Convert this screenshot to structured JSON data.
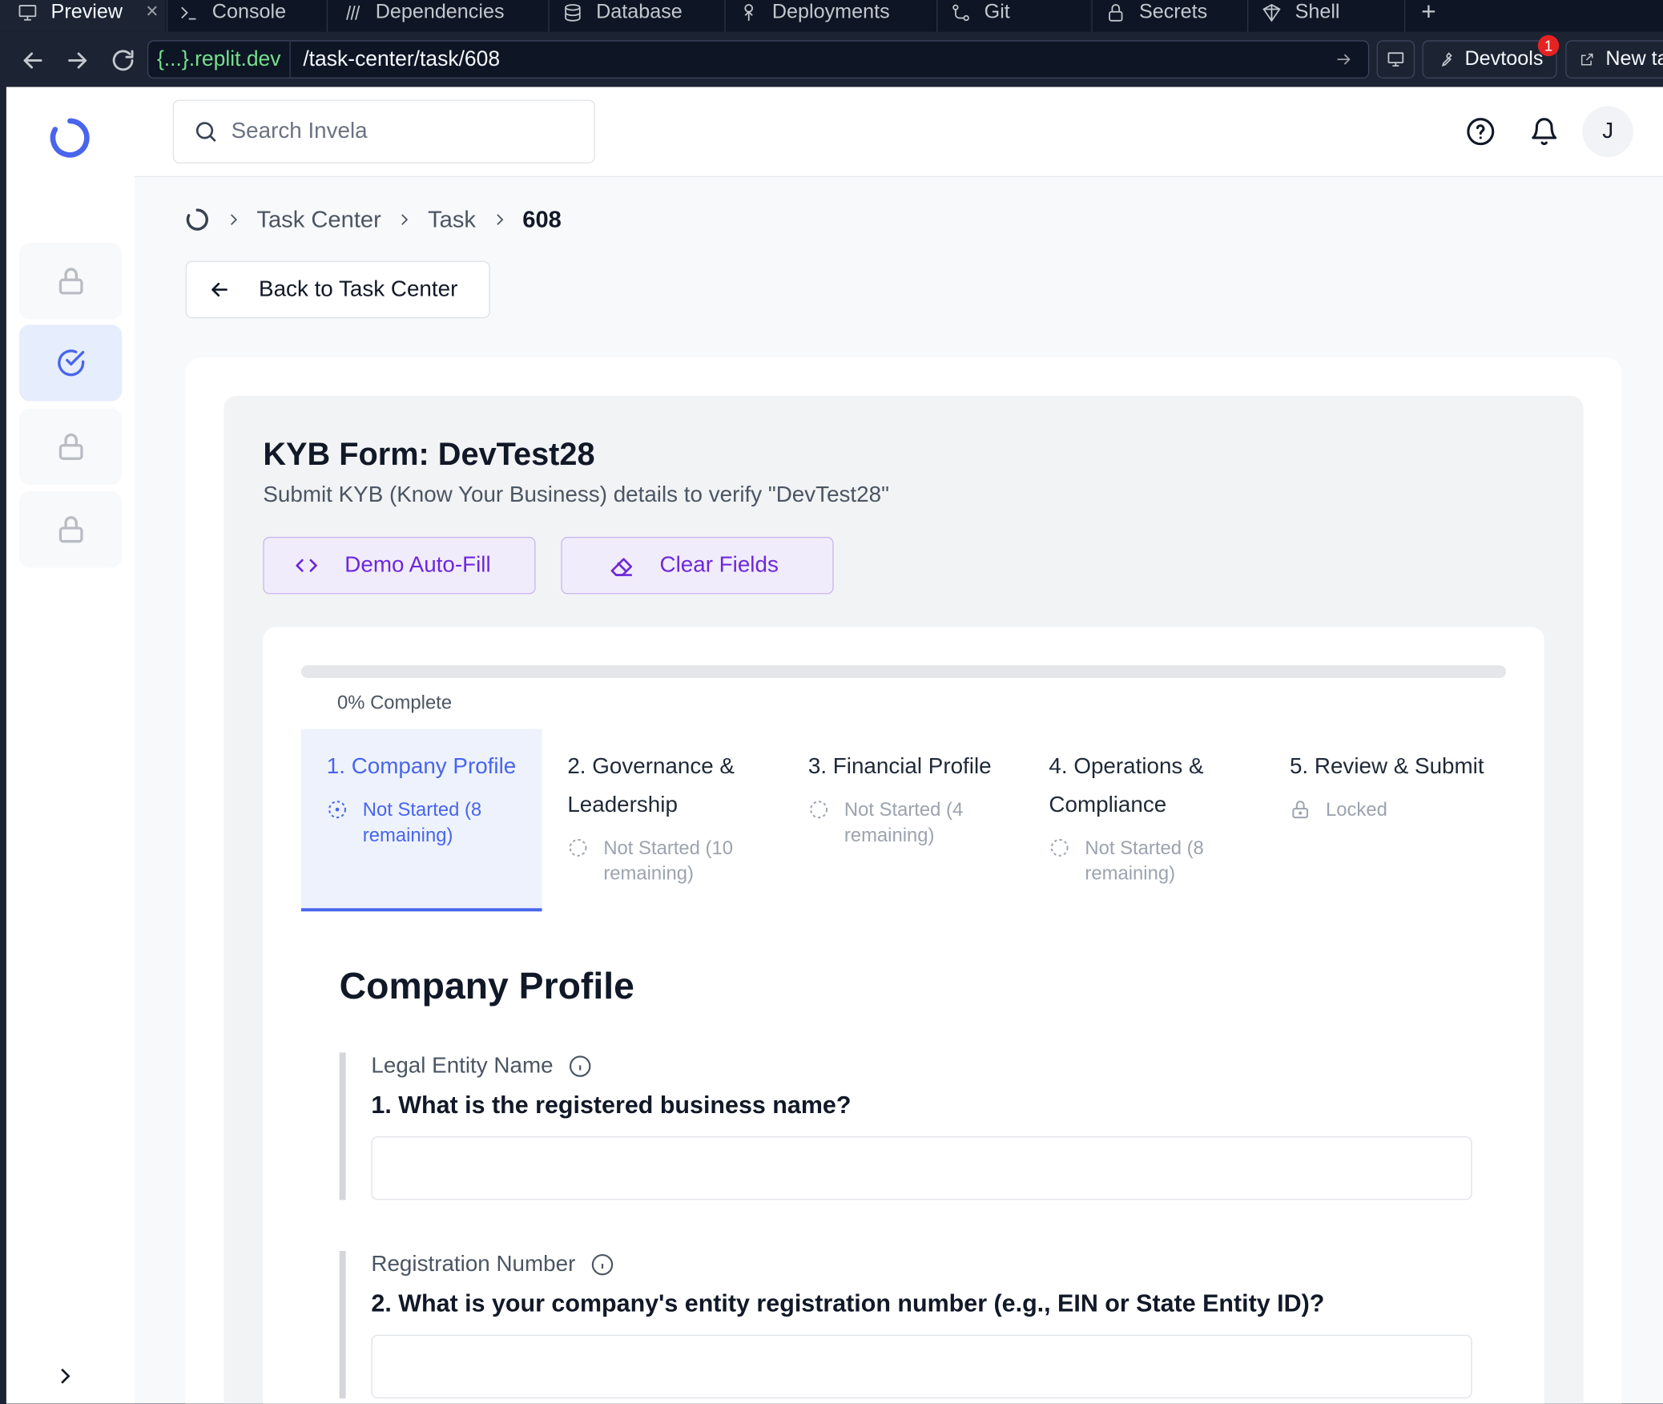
{
  "replit": {
    "tabs": [
      {
        "label": "Preview",
        "icon": "monitor-icon",
        "active": true
      },
      {
        "label": "Console",
        "icon": "terminal-icon"
      },
      {
        "label": "Dependencies",
        "icon": "dependencies-icon"
      },
      {
        "label": "Database",
        "icon": "database-icon"
      },
      {
        "label": "Deployments",
        "icon": "deployments-icon"
      },
      {
        "label": "Git",
        "icon": "git-icon"
      },
      {
        "label": "Secrets",
        "icon": "lock-icon"
      },
      {
        "label": "Shell",
        "icon": "shell-icon"
      }
    ],
    "close_glyph": "×",
    "add_tab_glyph": "+",
    "url_host": "{...}.replit.dev",
    "url_path": "/task-center/task/608",
    "devtools_label": "Devtools",
    "devtools_badge": "1",
    "new_tab_label": "New ta"
  },
  "app": {
    "search_placeholder": "Search Invela",
    "avatar_initial": "J",
    "breadcrumbs": [
      "Task Center",
      "Task",
      "608"
    ],
    "back_label": "Back to Task Center",
    "form_title": "KYB Form: DevTest28",
    "form_subtitle": "Submit KYB (Know Your Business) details to verify \"DevTest28\"",
    "demo_autofill_label": "Demo Auto-Fill",
    "clear_fields_label": "Clear Fields",
    "progress": {
      "percent": 0,
      "label": "0% Complete"
    },
    "steps": [
      {
        "title": "1. Company Profile",
        "status": "Not Started (8 remaining)",
        "active": true
      },
      {
        "title": "2. Governance & Leadership",
        "status": "Not Started (10 remaining)"
      },
      {
        "title": "3. Financial Profile",
        "status": "Not Started (4 remaining)"
      },
      {
        "title": "4. Operations & Compliance",
        "status": "Not Started (8 remaining)"
      },
      {
        "title": "5. Review & Submit",
        "status": "Locked",
        "locked": true
      }
    ],
    "section_title": "Company Profile",
    "questions": [
      {
        "label": "Legal Entity Name",
        "text": "1. What is the registered business name?",
        "value": ""
      },
      {
        "label": "Registration Number",
        "text": "2. What is your company's entity registration number (e.g., EIN or State Entity ID)?",
        "value": ""
      }
    ]
  },
  "colors": {
    "accent": "#4965ec",
    "purple": "#6d28d9",
    "replit_bg": "#1c2333",
    "host_green": "#74e08b"
  }
}
